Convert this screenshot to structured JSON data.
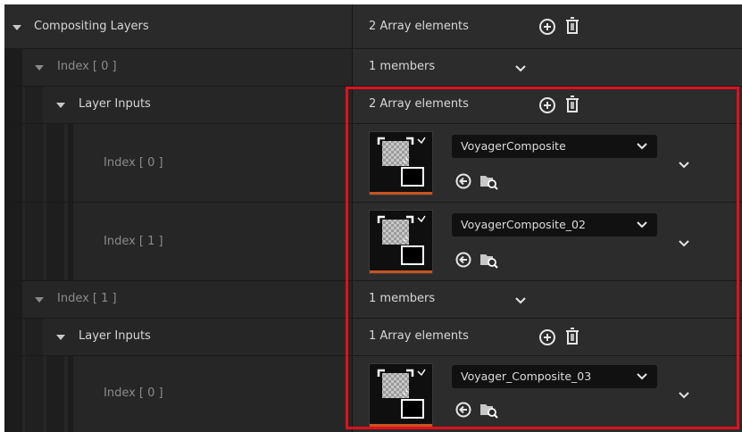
{
  "root": {
    "label": "Compositing Layers",
    "value": "2 Array elements"
  },
  "index0": {
    "label": "Index [ 0 ]",
    "value": "1 members",
    "layer_inputs": {
      "label": "Layer Inputs",
      "value": "2 Array elements",
      "elements": [
        {
          "label": "Index [ 0 ]",
          "asset": "VoyagerComposite"
        },
        {
          "label": "Index [ 1 ]",
          "asset": "VoyagerComposite_02"
        }
      ]
    }
  },
  "index1": {
    "label": "Index [ 1 ]",
    "value": "1 members",
    "layer_inputs": {
      "label": "Layer Inputs",
      "value": "1 Array elements",
      "elements": [
        {
          "label": "Index [ 0 ]",
          "asset": "Voyager_Composite_03"
        }
      ]
    }
  },
  "icons": {
    "add": "add-element-icon",
    "delete": "trash-icon",
    "chevron": "chevron-down-icon",
    "use_selected": "use-selected-arrow-icon",
    "browse": "browse-folder-icon",
    "thumbnail": "composite-asset-thumbnail"
  },
  "colors": {
    "highlight": "#e0101c",
    "thumbnail_bar": "#c8541f"
  }
}
